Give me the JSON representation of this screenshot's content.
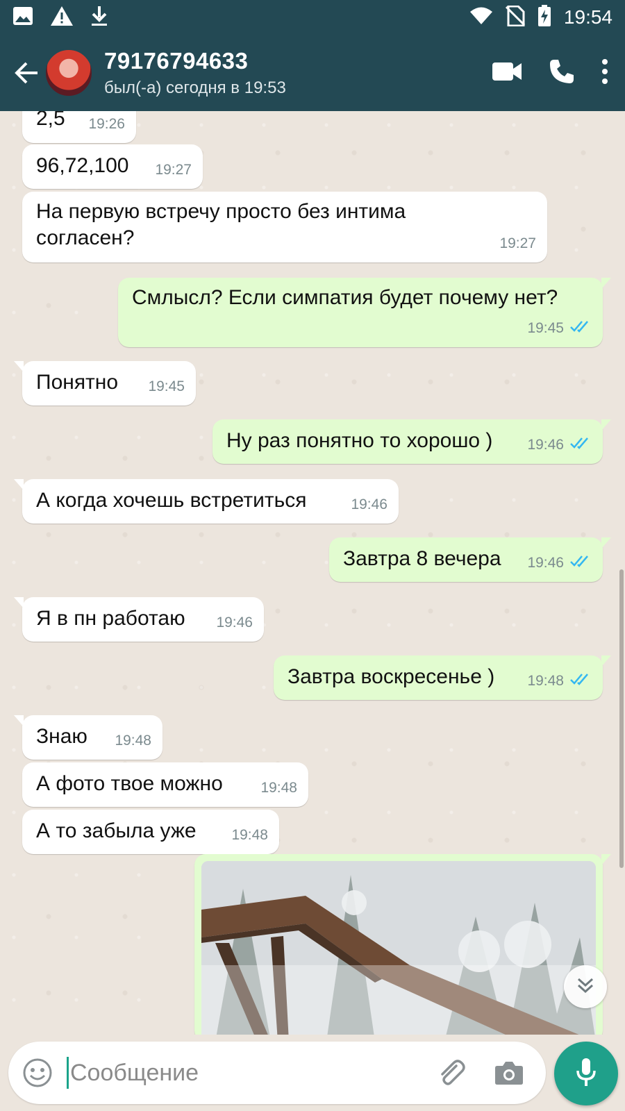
{
  "status_bar": {
    "time": "19:54",
    "left_icons": [
      "image-icon",
      "warning-icon",
      "download-icon"
    ],
    "right_icons": [
      "wifi-icon",
      "no-sim-icon",
      "battery-charging-icon"
    ]
  },
  "header": {
    "contact_name": "79176794633",
    "last_seen": "был(-а) сегодня в 19:53",
    "actions": [
      "video-call-icon",
      "phone-icon",
      "more-vert-icon"
    ]
  },
  "messages": [
    {
      "dir": "in",
      "text": "2,5",
      "time": "19:26"
    },
    {
      "dir": "in",
      "text": "96,72,100",
      "time": "19:27"
    },
    {
      "dir": "in",
      "text": "На первую встречу просто без интима\nсогласен?",
      "time": "19:27"
    },
    {
      "dir": "out",
      "text": "Смлысл? Если симпатия будет почему нет?",
      "time": "19:45",
      "status": "read"
    },
    {
      "dir": "in",
      "text": "Понятно",
      "time": "19:45"
    },
    {
      "dir": "out",
      "text": "Ну раз понятно то хорошо )",
      "time": "19:46",
      "status": "read"
    },
    {
      "dir": "in",
      "text": "А когда хочешь встретиться",
      "time": "19:46"
    },
    {
      "dir": "out",
      "text": "Завтра 8 вечера",
      "time": "19:46",
      "status": "read"
    },
    {
      "dir": "in",
      "text": "Я в пн работаю",
      "time": "19:46"
    },
    {
      "dir": "out",
      "text": "Завтра воскресенье )",
      "time": "19:48",
      "status": "read"
    },
    {
      "dir": "in",
      "text": "Знаю",
      "time": "19:48"
    },
    {
      "dir": "in",
      "text": "А фото твое можно",
      "time": "19:48"
    },
    {
      "dir": "in",
      "text": "А то забыла уже",
      "time": "19:48"
    },
    {
      "dir": "out",
      "type": "image",
      "description": "snowy-trees-photo"
    }
  ],
  "composer": {
    "placeholder": "Сообщение",
    "value": ""
  },
  "colors": {
    "header_bg": "#234954",
    "chat_bg": "#ece5dd",
    "out_bubble": "#e2fcd0",
    "in_bubble": "#ffffff",
    "accent": "#1fa08a",
    "read_ticks": "#34b7f1"
  }
}
